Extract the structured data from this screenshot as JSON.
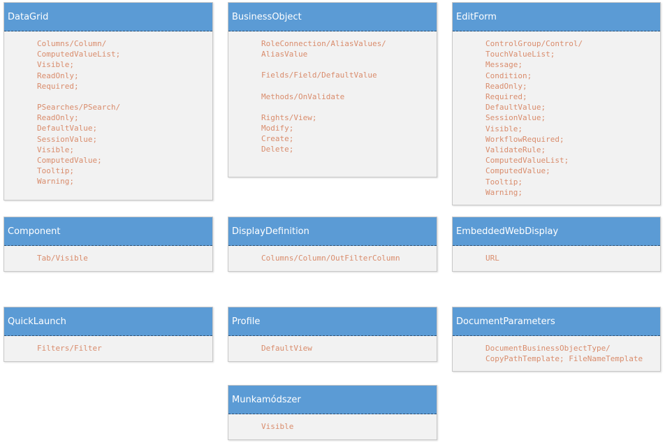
{
  "boxes": [
    {
      "id": "datagrid",
      "title": "DataGrid",
      "groups": [
        [
          "Columns/Column/",
          "ComputedValueList;",
          "Visible;",
          "ReadOnly;",
          "Required;"
        ],
        [
          "PSearches/PSearch/",
          "ReadOnly;",
          "DefaultValue;",
          "SessionValue;",
          "Visible;",
          "ComputedValue;",
          "Tooltip;",
          "Warning;"
        ]
      ]
    },
    {
      "id": "businessobject",
      "title": "BusinessObject",
      "groups": [
        [
          "RoleConnection/AliasValues/",
          "AliasValue"
        ],
        [
          "Fields/Field/DefaultValue"
        ],
        [
          "Methods/OnValidate"
        ],
        [
          "Rights/View;",
          "Modify;",
          "Create;",
          "Delete;"
        ]
      ]
    },
    {
      "id": "editform",
      "title": "EditForm",
      "groups": [
        [
          "ControlGroup/Control/",
          "TouchValueList;",
          "Message;",
          "Condition;",
          "ReadOnly;",
          "Required;",
          "DefaultValue;",
          "SessionValue;",
          "Visible;",
          "WorkflowRequired;",
          "ValidateRule;",
          "ComputedValueList;",
          "ComputedValue;",
          "Tooltip;",
          "Warning;"
        ]
      ]
    },
    {
      "id": "component",
      "title": "Component",
      "groups": [
        [
          "Tab/Visible"
        ]
      ]
    },
    {
      "id": "displaydefinition",
      "title": "DisplayDefinition",
      "groups": [
        [
          "Columns/Column/OutFilterColumn"
        ]
      ]
    },
    {
      "id": "embeddedwebdisplay",
      "title": "EmbeddedWebDisplay",
      "groups": [
        [
          "URL"
        ]
      ]
    },
    {
      "id": "quicklaunch",
      "title": "QuickLaunch",
      "groups": [
        [
          "Filters/Filter"
        ]
      ]
    },
    {
      "id": "profile",
      "title": "Profile",
      "groups": [
        [
          "DefaultView"
        ]
      ]
    },
    {
      "id": "documentparameters",
      "title": "DocumentParameters",
      "groups": [
        [
          "DocumentBusinessObjectType/",
          "CopyPathTemplate; FileNameTemplate"
        ]
      ]
    },
    {
      "id": "munkamodszer",
      "title": "Munkamódszer",
      "groups": [
        [
          "Visible"
        ]
      ]
    }
  ]
}
